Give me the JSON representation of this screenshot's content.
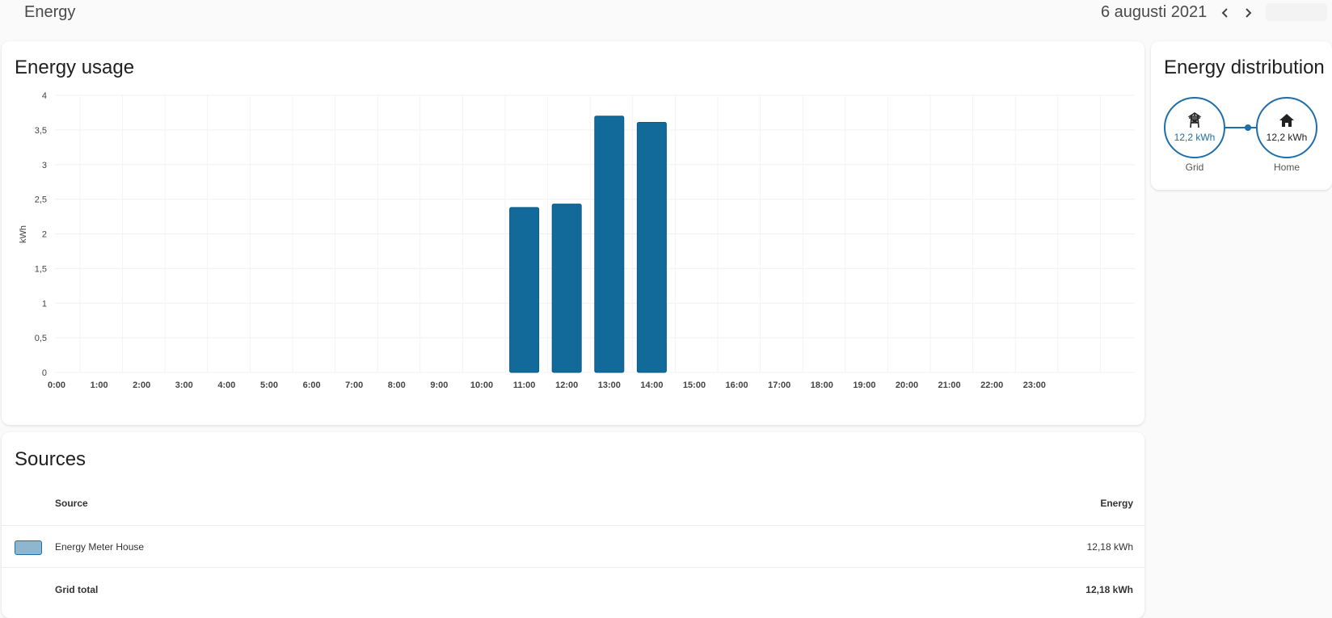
{
  "header": {
    "title": "Energy",
    "date": "6 augusti 2021",
    "prev_icon": "chevron-left-icon",
    "next_icon": "chevron-right-icon",
    "today_label": ""
  },
  "usage_card": {
    "title": "Energy usage"
  },
  "chart_data": {
    "type": "bar",
    "title": "",
    "xlabel": "",
    "ylabel": "kWh",
    "categories": [
      "0:00",
      "1:00",
      "2:00",
      "3:00",
      "4:00",
      "5:00",
      "6:00",
      "7:00",
      "8:00",
      "9:00",
      "10:00",
      "11:00",
      "12:00",
      "13:00",
      "14:00",
      "15:00",
      "16:00",
      "17:00",
      "18:00",
      "19:00",
      "20:00",
      "21:00",
      "22:00",
      "23:00"
    ],
    "values": [
      0,
      0,
      0,
      0,
      0,
      0,
      0,
      0,
      0,
      0,
      0,
      2.38,
      2.43,
      3.7,
      3.61,
      0,
      0,
      0,
      0,
      0,
      0,
      0,
      0,
      0
    ],
    "ylim": [
      0,
      4
    ],
    "yticks": [
      "0",
      "0,5",
      "1",
      "1,5",
      "2",
      "2,5",
      "3",
      "3,5",
      "4"
    ],
    "grid": true,
    "legend": "none",
    "bar_color": "#126a9a"
  },
  "distribution_card": {
    "title": "Energy distribution",
    "grid": {
      "value": "12,2 kWh",
      "label": "Grid",
      "icon": "transmission-tower-icon"
    },
    "home": {
      "value": "12,2 kWh",
      "label": "Home",
      "icon": "home-icon"
    },
    "line_color": "#1f6ea8"
  },
  "sources_card": {
    "title": "Sources",
    "headers": {
      "source": "Source",
      "energy": "Energy"
    },
    "rows": [
      {
        "name": "Energy Meter House",
        "energy": "12,18 kWh",
        "swatch_color": "#8eb7cf"
      }
    ],
    "total": {
      "name": "Grid total",
      "energy": "12,18 kWh"
    }
  }
}
